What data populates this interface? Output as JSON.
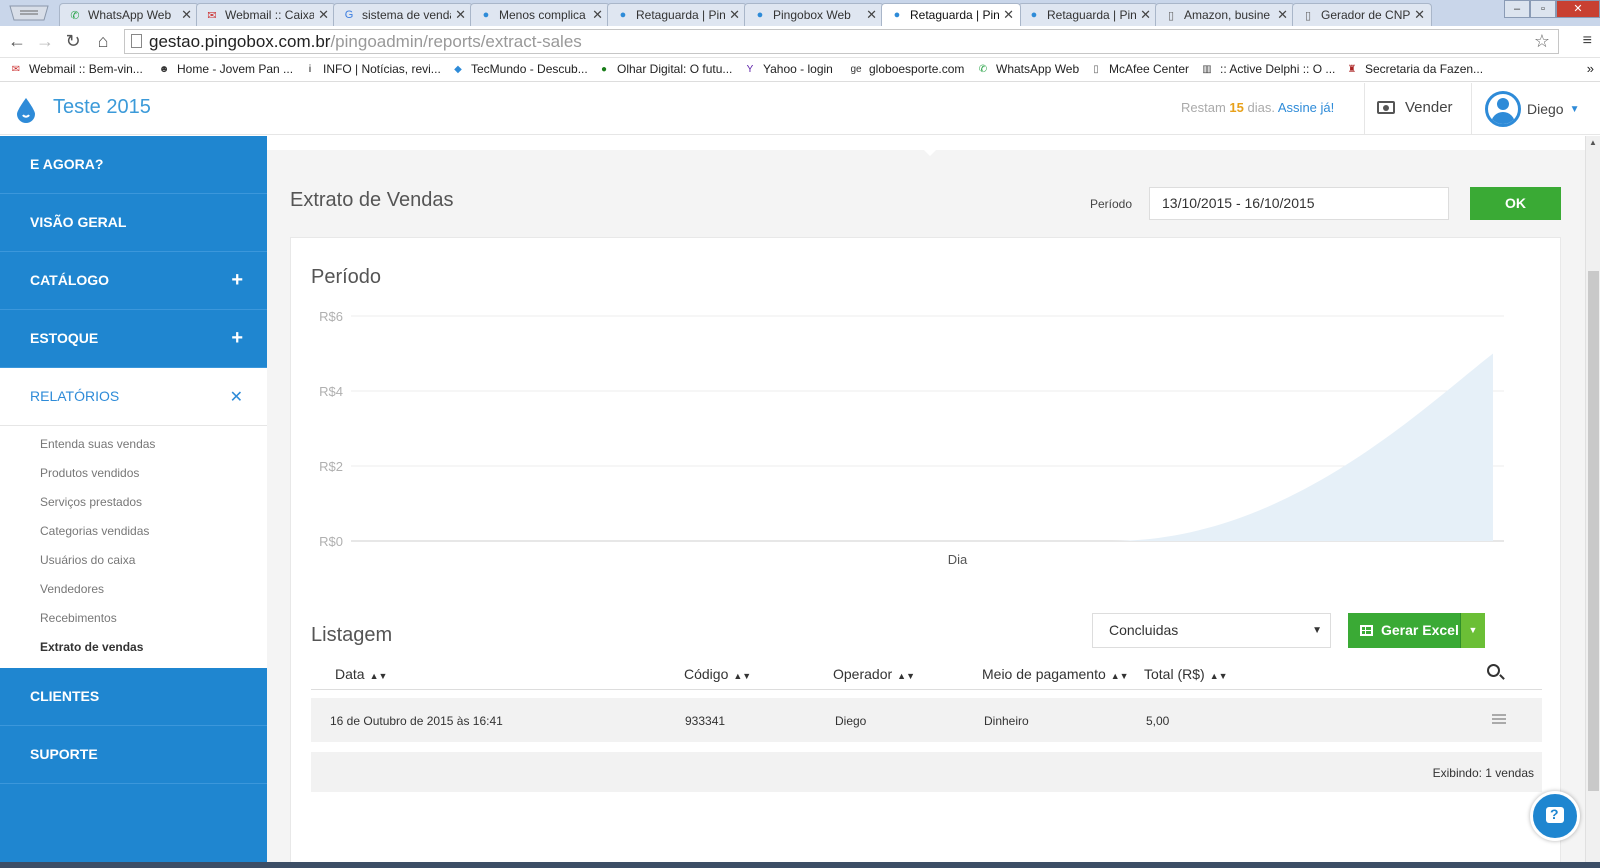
{
  "browser": {
    "tabs": [
      {
        "label": "WhatsApp Web",
        "icon": "whatsapp-icon"
      },
      {
        "label": "Webmail :: Caixa",
        "icon": "webmail-icon"
      },
      {
        "label": "sistema de venda",
        "icon": "google-icon"
      },
      {
        "label": "Menos complica",
        "icon": "pingobox-drop-icon"
      },
      {
        "label": "Retaguarda | Pin",
        "icon": "pingobox-drop-icon"
      },
      {
        "label": "Pingobox Web",
        "icon": "pingobox-drop-icon"
      },
      {
        "label": "Retaguarda | Pin",
        "icon": "pingobox-drop-icon"
      },
      {
        "label": "Retaguarda | Pin",
        "icon": "pingobox-drop-icon"
      },
      {
        "label": "Amazon, busine",
        "icon": "page-icon"
      },
      {
        "label": "Gerador de CNP",
        "icon": "page-icon"
      }
    ],
    "url_host": "gestao.pingobox.com.br",
    "url_path": "/pingoadmin/reports/extract-sales",
    "bookmarks": [
      {
        "label": "Webmail :: Bem-vin...",
        "icon": "webmail-icon"
      },
      {
        "label": "Home - Jovem Pan ...",
        "icon": "jovempan-icon"
      },
      {
        "label": "INFO | Notícias, revi...",
        "icon": "info-icon"
      },
      {
        "label": "TecMundo - Descub...",
        "icon": "tecmundo-icon"
      },
      {
        "label": "Olhar Digital: O futu...",
        "icon": "olhar-digital-icon"
      },
      {
        "label": "Yahoo - login",
        "icon": "yahoo-icon"
      },
      {
        "label": "globoesporte.com",
        "icon": "ge-icon"
      },
      {
        "label": "WhatsApp Web",
        "icon": "whatsapp-icon"
      },
      {
        "label": "McAfee Center",
        "icon": "page-icon"
      },
      {
        "label": ":: Active Delphi :: O ...",
        "icon": "delphi-icon"
      },
      {
        "label": "Secretaria da Fazen...",
        "icon": "fazenda-icon"
      }
    ]
  },
  "app": {
    "title": "Teste 2015",
    "trial_prefix": "Restam",
    "trial_days": "15",
    "trial_suffix": "dias.",
    "trial_link": "Assine já!",
    "sell_label": "Vender",
    "user_name": "Diego"
  },
  "sidebar": {
    "items_top": [
      {
        "label": "E AGORA?",
        "expandable": false
      },
      {
        "label": "VISÃO GERAL",
        "expandable": false
      },
      {
        "label": "CATÁLOGO",
        "expandable": true
      },
      {
        "label": "ESTOQUE",
        "expandable": true
      }
    ],
    "open_section": "RELATÓRIOS",
    "subitems": [
      "Entenda suas vendas",
      "Produtos vendidos",
      "Serviços prestados",
      "Categorias vendidas",
      "Usuários do caixa",
      "Vendedores",
      "Recebimentos",
      "Extrato de vendas"
    ],
    "current_subitem": "Extrato de vendas",
    "items_bottom": [
      {
        "label": "CLIENTES"
      },
      {
        "label": "SUPORTE"
      }
    ]
  },
  "main": {
    "page_title": "Extrato de Vendas",
    "period_label": "Período",
    "period_value": "13/10/2015 - 16/10/2015",
    "ok_label": "OK",
    "chart_heading": "Período",
    "list_heading": "Listagem",
    "status_select": "Concluidas",
    "excel_label": "Gerar Excel",
    "columns": [
      "Data",
      "Código",
      "Operador",
      "Meio de pagamento",
      "Total (R$)"
    ],
    "rows": [
      {
        "date": "16 de Outubro de 2015 às 16:41",
        "code": "933341",
        "operator": "Diego",
        "payment": "Dinheiro",
        "total": "5,00"
      }
    ],
    "footer": "Exibindo: 1 vendas"
  },
  "colors": {
    "brand_blue": "#1f86d0",
    "accent_green": "#3aaa35",
    "chart_fill": "#e6f0f8"
  },
  "chart_data": {
    "type": "area",
    "xlabel": "Dia",
    "ylabel": "",
    "yticks": [
      "R$0",
      "R$2",
      "R$4",
      "R$6"
    ],
    "ylim": [
      0,
      6
    ],
    "x": [
      0,
      1,
      2,
      3
    ],
    "values": [
      0,
      0,
      0,
      5
    ],
    "grid": true
  }
}
